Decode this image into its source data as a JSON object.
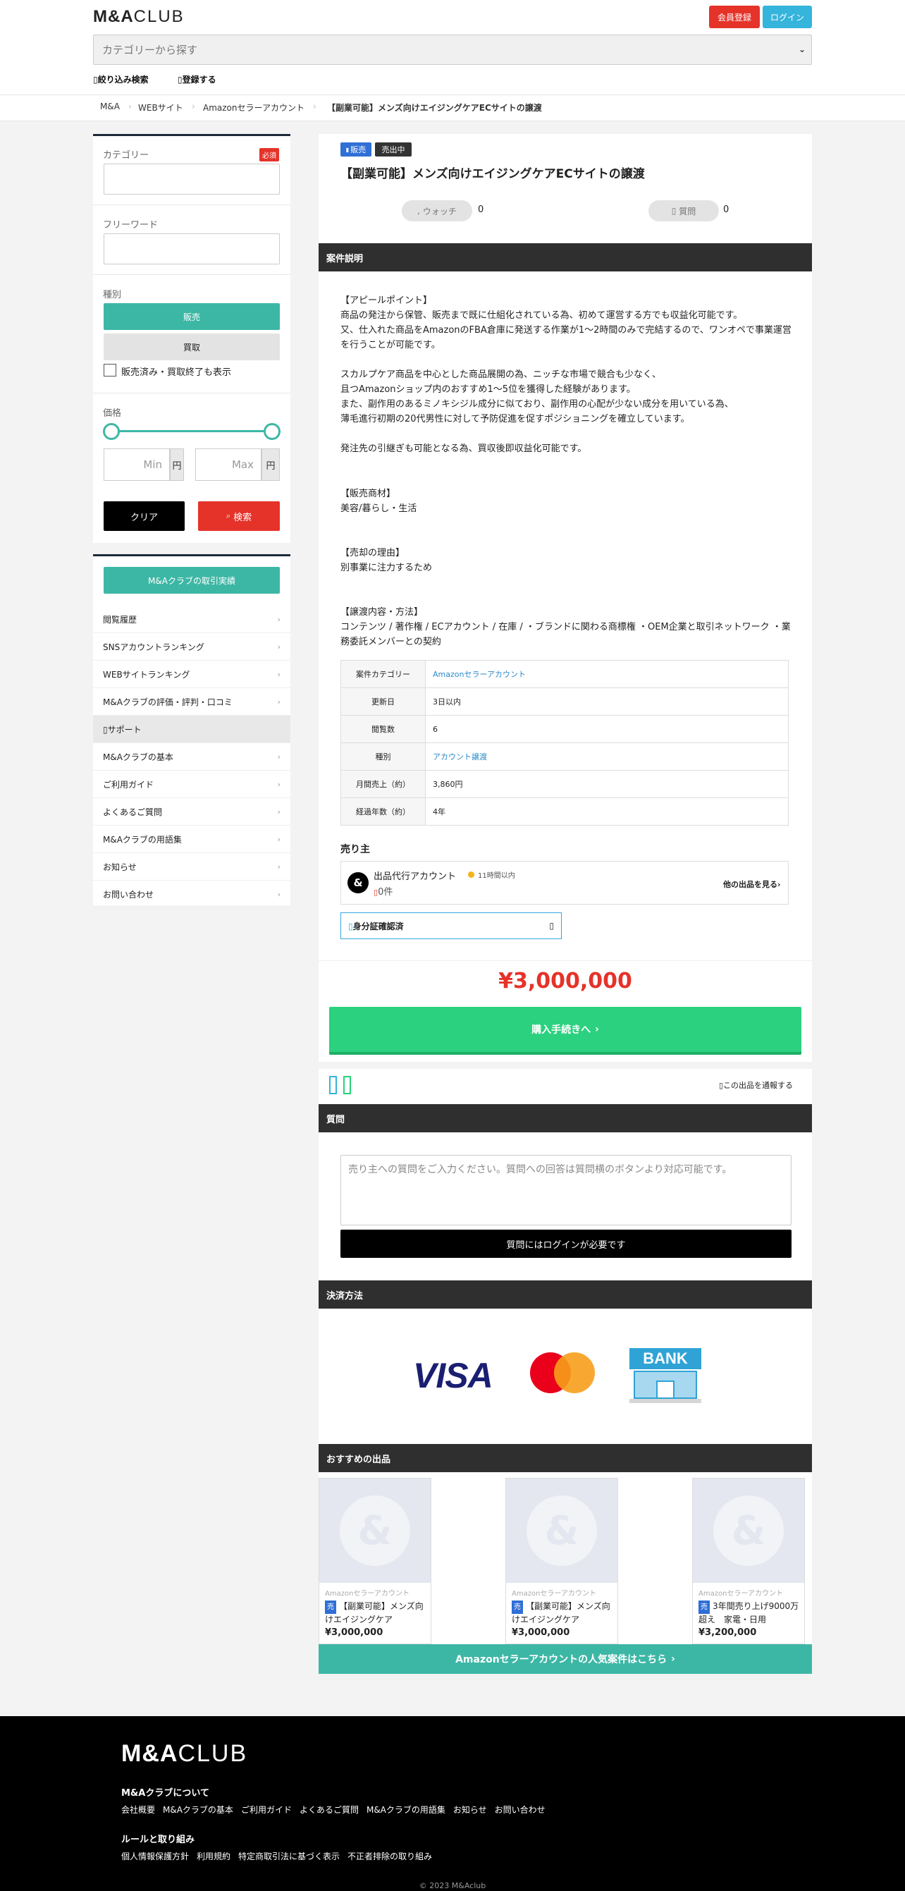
{
  "header": {
    "logo_main": "M&A",
    "logo_sub": "CLUB",
    "register": "会員登録",
    "login": "ログイン",
    "search_placeholder": "カテゴリーから探す",
    "filter_link": "絞り込み検索",
    "register_link": "登録する"
  },
  "breadcrumb": [
    "M&A",
    "WEBサイト",
    "Amazonセラーアカウント",
    "【副業可能】メンズ向けエイジングケアECサイトの譲渡"
  ],
  "filters": {
    "category_label": "カテゴリー",
    "required": "必須",
    "freeword_label": "フリーワード",
    "type_label": "種別",
    "sell": "販売",
    "buy": "買取",
    "show_closed": "販売済み・買取終了も表示",
    "price_label": "価格",
    "min_placeholder": "Min",
    "max_placeholder": "Max",
    "yen": "円",
    "clear": "クリア",
    "search": "検索"
  },
  "sidenav": {
    "cta": "M&Aクラブの取引実績",
    "items": [
      "閲覧履歴",
      "SNSアカウントランキング",
      "WEBサイトランキング",
      "M&Aクラブの評価・評判・口コミ"
    ],
    "support_head": "サポート",
    "support_items": [
      "M&Aクラブの基本",
      "ご利用ガイド",
      "よくあるご質問",
      "M&Aクラブの用語集",
      "お知らせ",
      "お問い合わせ"
    ]
  },
  "listing": {
    "badge_sell": "販売",
    "badge_status": "売出中",
    "title": "【副業可能】メンズ向けエイジングケアECサイトの譲渡",
    "watch_label": "ウォッチ",
    "watch_count": "0",
    "question_label": "質問",
    "question_count": "0",
    "desc_header": "案件説明",
    "desc_appeal": "【アピールポイント】\n商品の発注から保管、販売まで既に仕組化されている為、初めて運営する方でも収益化可能です。\n又、仕入れた商品をAmazonのFBA倉庫に発送する作業が1〜2時間のみで完結するので、ワンオペで事業運営を行うことが可能です。\n\nスカルプケア商品を中心とした商品展開の為、ニッチな市場で競合も少なく、\n且つAmazonショップ内のおすすめ1〜5位を獲得した経験があります。\nまた、副作用のあるミノキシジル成分に似ており、副作用の心配が少ない成分を用いている為、\n薄毛進行初期の20代男性に対して予防促進を促すポジショニングを確立しています。\n\n発注先の引継ぎも可能となる為、買収後即収益化可能です。",
    "desc_goods": "【販売商材】\n美容/暮らし・生活",
    "desc_reason": "【売却の理由】\n別事業に注力するため",
    "desc_transfer": "【譲渡内容・方法】\nコンテンツ / 著作権 / ECアカウント / 在庫 / ・ブランドに関わる商標権 ・OEM企業と取引ネットワーク ・業務委託メンバーとの契約",
    "info": [
      {
        "k": "案件カテゴリー",
        "v": "Amazonセラーアカウント",
        "link": true
      },
      {
        "k": "更新日",
        "v": "3日以内",
        "link": false
      },
      {
        "k": "閲覧数",
        "v": "6",
        "link": false
      },
      {
        "k": "種別",
        "v": "アカウント譲渡",
        "link": true
      },
      {
        "k": "月間売上（約）",
        "v": "3,860円",
        "link": false
      },
      {
        "k": "経過年数（約）",
        "v": "4年",
        "link": false
      }
    ],
    "seller_heading": "売り主",
    "seller_name": "出品代行アカウント",
    "seller_status": "11時間以内",
    "seller_count": "0件",
    "seller_more": "他の出品を見る",
    "verify": "身分証確認済",
    "price": "¥3,000,000",
    "buy": "購入手続きへ",
    "report": "この出品を通報する",
    "qa_header": "質問",
    "qa_placeholder": "売り主への質問をご入力ください。質問への回答は質問横のボタンより対応可能です。",
    "qa_login": "質問にはログインが必要です",
    "pay_header": "決済方法",
    "pay_visa": "VISA",
    "pay_bank": "BANK",
    "rec_header": "おすすめの出品",
    "recommend": [
      {
        "cat": "Amazonセラーアカウント",
        "badge": "売",
        "title": "【副業可能】メンズ向けエイジングケア",
        "price": "¥3,000,000"
      },
      {
        "cat": "Amazonセラーアカウント",
        "badge": "売",
        "title": "【副業可能】メンズ向けエイジングケア",
        "price": "¥3,000,000"
      },
      {
        "cat": "Amazonセラーアカウント",
        "badge": "売",
        "title": "3年間売り上げ9000万超え　家電・日用",
        "price": "¥3,200,000"
      }
    ],
    "more": "Amazonセラーアカウントの人気案件はこちら"
  },
  "footer": {
    "about_head": "M&Aクラブについて",
    "about_links": [
      "会社概要",
      "M&Aクラブの基本",
      "ご利用ガイド",
      "よくあるご質問",
      "M&Aクラブの用語集",
      "お知らせ",
      "お問い合わせ"
    ],
    "rules_head": "ルールと取り組み",
    "rules_links": [
      "個人情報保護方針",
      "利用規約",
      "特定商取引法に基づく表示",
      "不正者排除の取り組み"
    ],
    "copyright": "© 2023 M&Aclub"
  },
  "colors": {
    "red": "#e5332a",
    "teal": "#3db7a5",
    "green": "#2bd17e",
    "blue": "#35b4dc",
    "dark": "#2f2f2f"
  }
}
